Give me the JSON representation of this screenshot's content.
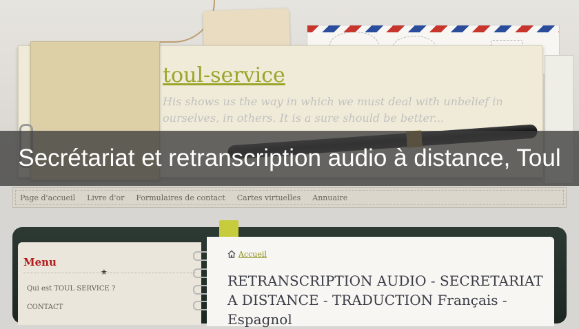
{
  "site": {
    "title": "toul-service"
  },
  "header": {
    "handwriting": "His shows us the way in which we must deal with unbelief in ourselves, in others. It is a sure should be better..."
  },
  "banner": {
    "text": "Secrétariat et retranscription audio à distance, Toul"
  },
  "nav": {
    "items": [
      "Page d'accueil",
      "Livre d'or",
      "Formulaires de contact",
      "Cartes virtuelles",
      "Annuaire"
    ]
  },
  "sidebar": {
    "title": "Menu",
    "items": [
      "Qui est TOUL SERVICE ?",
      "CONTACT"
    ]
  },
  "breadcrumb": {
    "home_label": "Accueil"
  },
  "main": {
    "heading": "RETRANSCRIPTION AUDIO - SECRETARIAT A DISTANCE - TRADUCTION Français - Espagnol"
  },
  "colors": {
    "accent": "#98a52a",
    "menu_title": "#b01d1d",
    "banner_bg": "rgba(60,60,60,0.78)"
  }
}
